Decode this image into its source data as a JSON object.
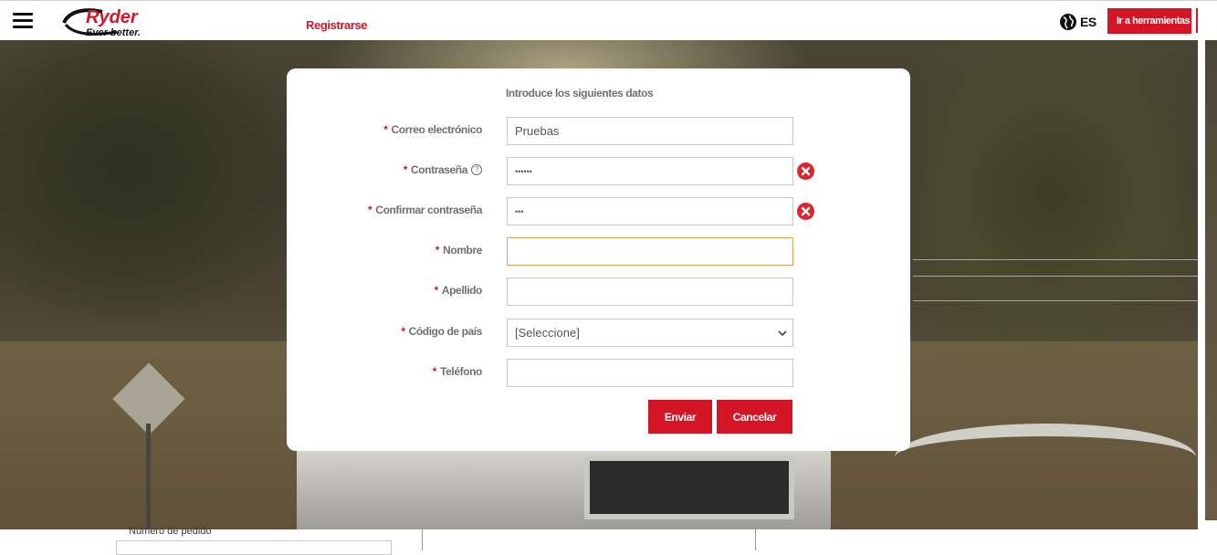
{
  "header": {
    "register_label": "Registrarse",
    "language": "ES",
    "tools_button": "Ir a herramientas",
    "logo": {
      "brand": "Ryder",
      "tagline": "Ever better."
    },
    "accent_color": "#d31526"
  },
  "modal": {
    "title": "Introduce los siguientes datos",
    "fields": {
      "email": {
        "label": "Correo electrónico",
        "value": "Pruebas"
      },
      "password": {
        "label": "Contraseña",
        "value": "••••••",
        "help_icon": "question-circle-icon",
        "error_icon": "error-circle-icon"
      },
      "confirm_password": {
        "label": "Confirmar contraseña",
        "value": "•••",
        "error_icon": "error-circle-icon"
      },
      "first_name": {
        "label": "Nombre",
        "value": ""
      },
      "last_name": {
        "label": "Apellido",
        "value": ""
      },
      "country_code": {
        "label": "Código de país",
        "selected": "[Seleccione]"
      },
      "phone": {
        "label": "Teléfono",
        "value": ""
      }
    },
    "required_marker": "*",
    "buttons": {
      "submit": "Enviar",
      "cancel": "Cancelar"
    }
  },
  "below_page": {
    "order_label": "Número de pedido"
  }
}
